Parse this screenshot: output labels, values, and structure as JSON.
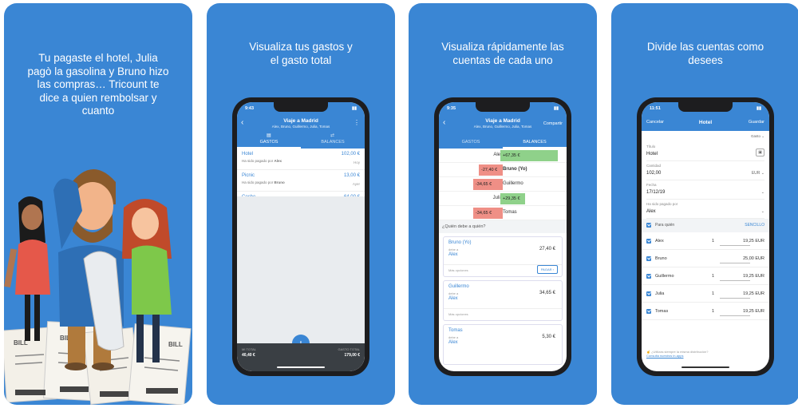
{
  "panels": [
    {
      "caption": "Tu pagaste el hotel, Julia pagò la gasolina y Bruno hizo las compras… Tricount te dice a quien rembolsar y cuanto",
      "receipt_label": "BILL"
    },
    {
      "caption": "Visualiza tus gastos y el gasto total"
    },
    {
      "caption": "Visualiza rápidamente las cuentas de cada uno"
    },
    {
      "caption": "Divide las cuentas como desees"
    }
  ],
  "expenses_screen": {
    "time": "9:43",
    "title": "Viaje a Madrid",
    "subtitle": "Alex, Bruno, Guillermo, Julia, Tomas",
    "tab_gastos": "GASTOS",
    "tab_balances": "BALANCES",
    "items": [
      {
        "title": "Hotel",
        "amount": "102,00 €",
        "paid_by": "Ha sido pagado por",
        "payer": "Alex",
        "date": "Hoy"
      },
      {
        "title": "Picnic",
        "amount": "13,00 €",
        "paid_by": "Ha sido pagado por",
        "payer": "Bruno",
        "date": "Ayer"
      },
      {
        "title": "Coche",
        "amount": "64,00 €",
        "paid_by": "Ha sido pagado por",
        "payer": "Julia",
        "date": "Ayer"
      }
    ],
    "my_total_label": "MI TOTAL",
    "my_total": "40,40 €",
    "total_label": "GASTO TOTAL",
    "total": "179,00 €"
  },
  "balances_screen": {
    "time": "9:35",
    "title": "Viaje a Madrid",
    "subtitle": "Alex, Bruno, Guillermo, Julia, Tomas",
    "share": "Compartir",
    "tab_gastos": "GASTOS",
    "tab_balances": "BALANCES",
    "rows": [
      {
        "name": "Alex",
        "amount": "+67,35 €",
        "value": 67.35
      },
      {
        "name": "Bruno (Yo)",
        "amount": "-27,40 €",
        "value": -27.4
      },
      {
        "name": "Guillermo",
        "amount": "-34,65 €",
        "value": -34.65
      },
      {
        "name": "Julia",
        "amount": "+29,35 €",
        "value": 29.35
      },
      {
        "name": "Tomas",
        "amount": "-34,65 €",
        "value": -34.65
      }
    ],
    "section": "¿Quién debe a quién?",
    "owes_label": "debe a",
    "more_label": "Más opciones",
    "pay_label": "PAGAR",
    "debts": [
      {
        "from": "Bruno (Yo)",
        "to": "Alex",
        "amount": "27,40 €"
      },
      {
        "from": "Guillermo",
        "to": "Alex",
        "amount": "34,65 €"
      },
      {
        "from": "Tomas",
        "to": "Alex",
        "amount": "5,30 €"
      }
    ]
  },
  "edit_screen": {
    "time": "11:51",
    "cancel": "Cancelar",
    "title": "Hotel",
    "save": "Guardar",
    "type": "Gasto",
    "title_label": "Título",
    "title_value": "Hotel",
    "amount_label": "Cantidad",
    "amount_value": "102,00",
    "currency": "EUR",
    "date_label": "Fecha",
    "date_value": "17/12/19",
    "payer_label": "Ha sido pagado por",
    "payer_value": "Alex",
    "for_whom": "Para quién",
    "mode": "SENCILLO",
    "participants": [
      {
        "name": "Alex",
        "qty": "1",
        "amount": "19,25 EUR"
      },
      {
        "name": "Bruno",
        "qty": "",
        "amount": "25,00 EUR"
      },
      {
        "name": "Guillermo",
        "qty": "1",
        "amount": "19,25 EUR"
      },
      {
        "name": "Julia",
        "qty": "1",
        "amount": "19,25 EUR"
      },
      {
        "name": "Tomas",
        "qty": "1",
        "amount": "19,25 EUR"
      }
    ],
    "hint": "¿Utilizas siempre la misma distribución?",
    "hint_link": "Consulta nuestros in-apps"
  },
  "colors": {
    "brand": "#3a86d4",
    "positive": "#8fd18a",
    "negative": "#ef8f86",
    "dark": "#1d1d1f"
  }
}
